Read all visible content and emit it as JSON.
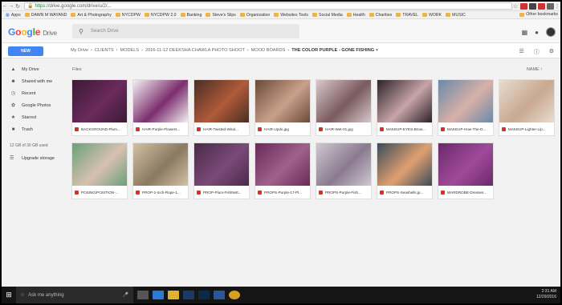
{
  "browser": {
    "url_secure_label": "https:",
    "url_rest": "//drive.google.com/drive/u/2/..."
  },
  "bookmarks": {
    "items": [
      "Apps",
      "DAWN M WAYAND",
      "Art & Photography",
      "NYCDPW",
      "NYCDPW 2.0",
      "Banking",
      "Steve's Slips",
      "Organization",
      "Websites Tools",
      "Social Media",
      "Health",
      "Charities",
      "TRAVEL",
      "WORK",
      "MUSIC"
    ],
    "other": "Other bookmarks"
  },
  "header": {
    "logo_google": "Google",
    "logo_drive": "Drive",
    "search_placeholder": "Search Drive"
  },
  "new_button": "NEW",
  "breadcrumb": {
    "items": [
      "My Drive",
      "CLIENTS",
      "MODELS",
      "2016-11-12 DEEKSHA CHAWLA PHOTO SHOOT",
      "MOOD BOARDS"
    ],
    "current": "THE COLOR PURPLE - GONE FISHING"
  },
  "sidebar": {
    "items": [
      {
        "label": "My Drive",
        "icon": "my-drive-icon"
      },
      {
        "label": "Shared with me",
        "icon": "shared-icon"
      },
      {
        "label": "Recent",
        "icon": "clock-icon"
      },
      {
        "label": "Google Photos",
        "icon": "photos-icon"
      },
      {
        "label": "Starred",
        "icon": "star-icon"
      },
      {
        "label": "Trash",
        "icon": "trash-icon"
      }
    ],
    "storage": "12 GB of 30 GB used",
    "upgrade": "Upgrade storage"
  },
  "main": {
    "files_label": "Files",
    "sort_label": "NAME"
  },
  "files": [
    {
      "name": "BACKGROUND-Plum...",
      "c1": "#3a1a34",
      "c2": "#6b2a5c"
    },
    {
      "name": "HAIR-Purple-Flowers...",
      "c1": "#f4f0f2",
      "c2": "#7b2e6e"
    },
    {
      "name": "HAIR-Twisted-Wind...",
      "c1": "#4a2e24",
      "c2": "#b05a3a"
    },
    {
      "name": "HAIR-Updo.jpg",
      "c1": "#6a4a3a",
      "c2": "#c9a08a"
    },
    {
      "name": "HAIR-Wet-01.jpg",
      "c1": "#d8c8cc",
      "c2": "#7a5a5e"
    },
    {
      "name": "MAKEUP-EYES-Brow...",
      "c1": "#2a2228",
      "c2": "#c8a4a8"
    },
    {
      "name": "MAKEUP-How-The-D...",
      "c1": "#6a8aa8",
      "c2": "#d8b0a8"
    },
    {
      "name": "MAKEUP-Lighter-Lip...",
      "c1": "#e8dcd0",
      "c2": "#c8a890"
    },
    {
      "name": "POSING/POSITION-...",
      "c1": "#6aa07a",
      "c2": "#d8c0b0"
    },
    {
      "name": "PROP-2-Inch-Rope-1...",
      "c1": "#d4c0a4",
      "c2": "#8a7a62"
    },
    {
      "name": "PROP-Plum-FishNett...",
      "c1": "#4a2a48",
      "c2": "#7a4a78"
    },
    {
      "name": "PROPS-Purple-17-Pl...",
      "c1": "#6a2a58",
      "c2": "#a0608c"
    },
    {
      "name": "PROPS-Purple-Fish...",
      "c1": "#d0c8d0",
      "c2": "#8a7a90"
    },
    {
      "name": "PROPS-Seashells.jp...",
      "c1": "#3a4a5a",
      "c2": "#e0a070"
    },
    {
      "name": "WARDROBE-Dresses...",
      "c1": "#6a2a6a",
      "c2": "#a04a9a"
    }
  ],
  "taskbar": {
    "search_placeholder": "Ask me anything",
    "time": "2:31 AM",
    "date": "12/29/2016"
  }
}
